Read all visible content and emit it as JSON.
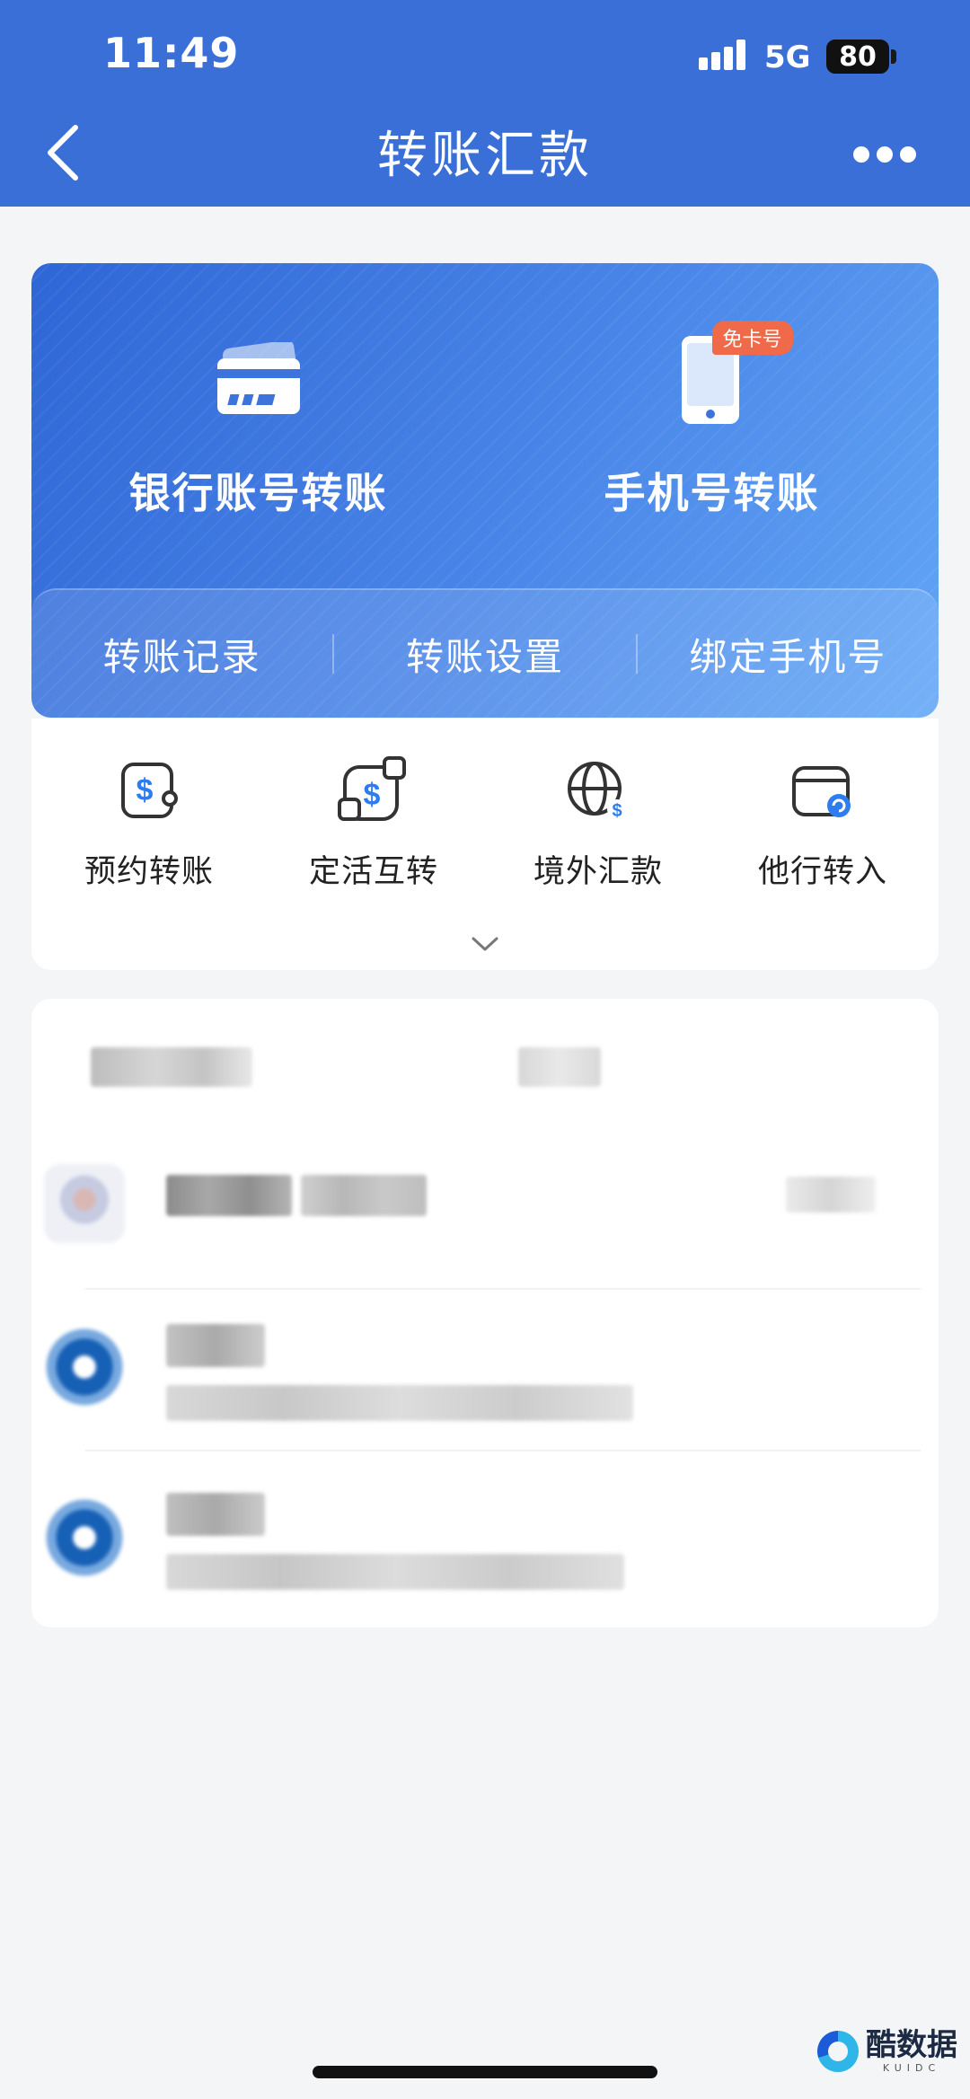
{
  "status_bar": {
    "time": "11:49",
    "network": "5G",
    "battery": "80"
  },
  "header": {
    "title": "转账汇款"
  },
  "hero": {
    "options": [
      {
        "label": "银行账号转账",
        "icon": "bank-card-icon"
      },
      {
        "label": "手机号转账",
        "icon": "phone-icon",
        "badge": "免卡号"
      }
    ],
    "links": [
      "转账记录",
      "转账设置",
      "绑定手机号"
    ]
  },
  "shortcuts": [
    {
      "label": "预约转账",
      "icon": "scheduled-transfer-icon"
    },
    {
      "label": "定活互转",
      "icon": "deposit-exchange-icon"
    },
    {
      "label": "境外汇款",
      "icon": "globe-dollar-icon"
    },
    {
      "label": "他行转入",
      "icon": "wallet-inbound-icon"
    }
  ],
  "watermark": {
    "title": "酷数据",
    "subtitle": "KUIDC"
  },
  "colors": {
    "brand": "#3a6fd8",
    "badge": "#f06a4a",
    "icon_accent": "#2d7cf0"
  }
}
